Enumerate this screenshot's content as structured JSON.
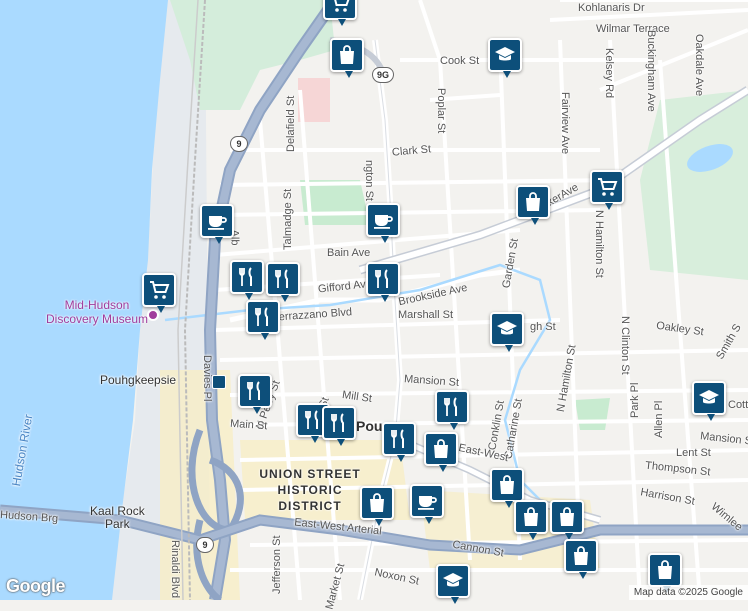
{
  "map": {
    "attribution": "Map data ©2025 Google",
    "logo": "Google",
    "city_label": "Poughkeepsie",
    "city_partial": "Pou",
    "district_label": [
      "UNION STREET",
      "HISTORIC",
      "DISTRICT"
    ],
    "museum_label": [
      "Mid-Hudson",
      "Discovery Museum"
    ],
    "river_label": [
      "Hudson River"
    ],
    "park_label": [
      "Kaal Rock",
      "Park"
    ],
    "highway_shields": [
      "9G",
      "9",
      "9"
    ],
    "streets": [
      "Kohlanaris Dr",
      "Wilmar Terrace",
      "Cook St",
      "Kelsey Rd",
      "Buckingham Ave",
      "Oakdale Ave",
      "Poplar St",
      "Clark St",
      "Fairview Ave",
      "Delafield St",
      "Talmadge St",
      "Bain Ave",
      "Gifford Av",
      "Garden St",
      "N Hamilton St",
      "Brookside Ave",
      "Verrazzano Blvd",
      "Marshall St",
      "Oakley St",
      "N Clinton St",
      "Smith S",
      "Davies Pl",
      "N Perry St",
      "Mill St",
      "Mansion St",
      "Park Pl",
      "Allen Pl",
      "Main St",
      "Conklin St",
      "Catharine St",
      "N Hamilton St",
      "Lent St",
      "Thompson St",
      "Harrison St",
      "Wimlee",
      "Jefferson St",
      "Cannon St",
      "East-West Arterial",
      "East-West",
      "Noxon St",
      "Market St",
      "Rinaldi Blvd",
      "Hudson Brg",
      "Hudson Brg",
      "ngton St",
      "kerAve",
      "Ave",
      "Pouhgkeepsie",
      "Mansion St",
      "Cotta",
      "gh St",
      "Alb",
      "Idge St",
      "Mid"
    ]
  },
  "pois": [
    {
      "type": "shopping-cart",
      "name": "cart-top"
    },
    {
      "type": "shopping-bag",
      "name": "bag-top"
    },
    {
      "type": "school",
      "name": "school-top"
    },
    {
      "type": "coffee",
      "name": "coffee-albany"
    },
    {
      "type": "coffee",
      "name": "coffee-washington"
    },
    {
      "type": "shopping-bag",
      "name": "bag-parker"
    },
    {
      "type": "shopping-cart",
      "name": "cart-parker"
    },
    {
      "type": "shopping-cart",
      "name": "cart-museum"
    },
    {
      "type": "restaurant",
      "name": "restaurant-gifford-1"
    },
    {
      "type": "restaurant",
      "name": "restaurant-gifford-2"
    },
    {
      "type": "restaurant",
      "name": "restaurant-gifford-3"
    },
    {
      "type": "restaurant",
      "name": "restaurant-verrazzano"
    },
    {
      "type": "school",
      "name": "school-garden"
    },
    {
      "type": "restaurant",
      "name": "restaurant-station"
    },
    {
      "type": "school",
      "name": "school-east"
    },
    {
      "type": "restaurant",
      "name": "restaurant-mansion"
    },
    {
      "type": "restaurant",
      "name": "restaurant-mill-1"
    },
    {
      "type": "restaurant",
      "name": "restaurant-mill-2"
    },
    {
      "type": "restaurant",
      "name": "restaurant-main"
    },
    {
      "type": "shopping-bag",
      "name": "bag-main"
    },
    {
      "type": "shopping-bag",
      "name": "bag-arterial"
    },
    {
      "type": "shopping-bag",
      "name": "bag-union"
    },
    {
      "type": "coffee",
      "name": "coffee-union"
    },
    {
      "type": "shopping-bag",
      "name": "bag-east-1"
    },
    {
      "type": "shopping-bag",
      "name": "bag-east-2"
    },
    {
      "type": "shopping-bag",
      "name": "bag-south"
    },
    {
      "type": "shopping-bag",
      "name": "bag-se"
    },
    {
      "type": "school",
      "name": "school-south"
    }
  ],
  "colors": {
    "water": "#aadaff",
    "park": "#c8ebd0",
    "road": "#ffffff",
    "highway": "#8fa4c4",
    "poi": "#0d4f7a",
    "commercial": "#f7eec6"
  }
}
